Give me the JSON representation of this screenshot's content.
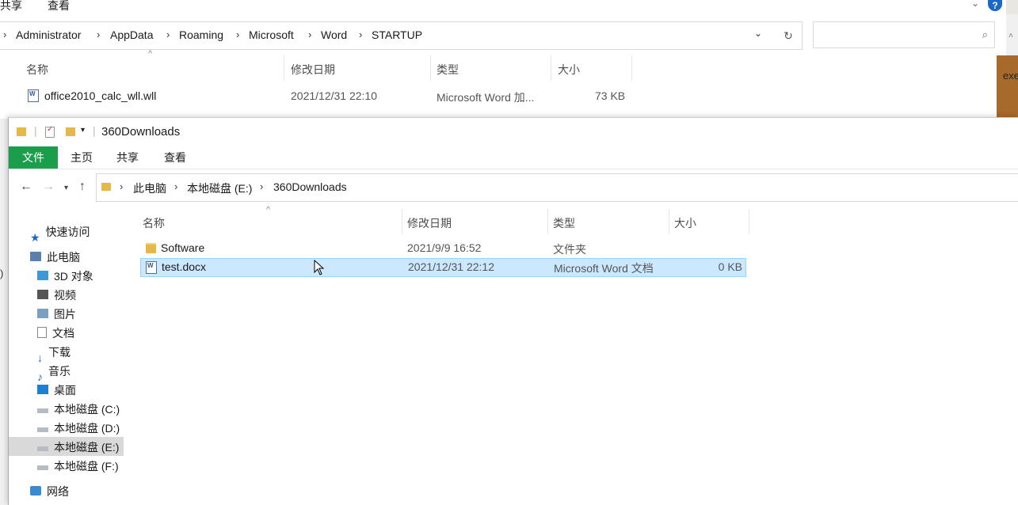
{
  "background_window": {
    "ribbon_tabs": [
      "共享",
      "查看"
    ],
    "breadcrumb": [
      "Administrator",
      "AppData",
      "Roaming",
      "Microsoft",
      "Word",
      "STARTUP"
    ],
    "columns": [
      "名称",
      "修改日期",
      "类型",
      "大小"
    ],
    "file": {
      "name": "office2010_calc_wll.wll",
      "date": "2021/12/31 22:10",
      "type": "Microsoft Word 加...",
      "size": "73 KB"
    },
    "help_label": "?",
    "side_snippet": "exe"
  },
  "window": {
    "title": "360Downloads",
    "ribbon_tabs": {
      "file": "文件",
      "home": "主页",
      "share": "共享",
      "view": "查看"
    },
    "breadcrumb": [
      "此电脑",
      "本地磁盘 (E:)",
      "360Downloads"
    ],
    "columns": {
      "name": "名称",
      "date": "修改日期",
      "type": "类型",
      "size": "大小"
    },
    "files": [
      {
        "name": "Software",
        "date": "2021/9/9 16:52",
        "type": "文件夹",
        "size": "",
        "icon": "folder-icon"
      },
      {
        "name": "test.docx",
        "date": "2021/12/31 22:12",
        "type": "Microsoft Word 文档",
        "size": "0 KB",
        "icon": "word-doc-icon"
      }
    ],
    "sidebar": {
      "quick_access": "快速访问",
      "this_pc": "此电脑",
      "items": [
        "3D 对象",
        "视频",
        "图片",
        "文档",
        "下载",
        "音乐",
        "桌面",
        "本地磁盘 (C:)",
        "本地磁盘 (D:)",
        "本地磁盘 (E:)",
        "本地磁盘 (F:)"
      ],
      "network": "网络"
    }
  },
  "colors": {
    "accent_file_tab": "#1a9e4b",
    "selection": "#cce8ff"
  }
}
